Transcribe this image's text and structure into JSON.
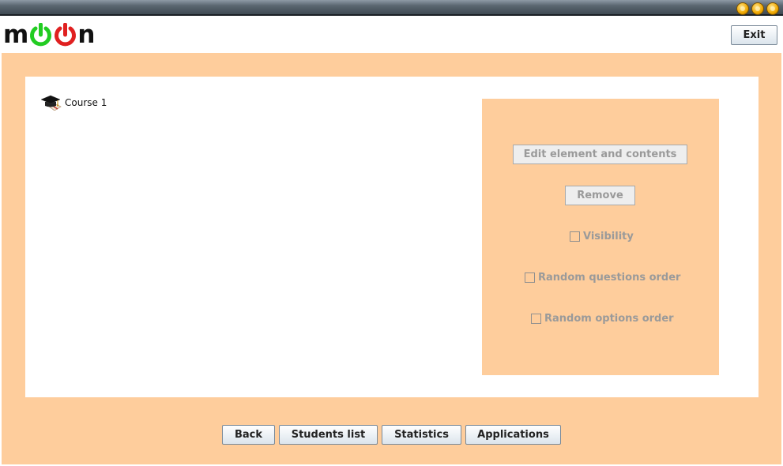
{
  "window": {
    "controls": [
      {
        "name": "minimize-icon"
      },
      {
        "name": "maximize-icon"
      },
      {
        "name": "close-icon"
      }
    ]
  },
  "header": {
    "logo": {
      "letters": [
        "m",
        "n"
      ],
      "power_colors": [
        "#22cc22",
        "#e02020"
      ]
    },
    "exit_label": "Exit"
  },
  "tree": {
    "items": [
      {
        "label": "Course 1",
        "icon": "graduation-cap-icon"
      }
    ]
  },
  "actions": {
    "edit_label": "Edit element and contents",
    "remove_label": "Remove",
    "visibility_label": "Visibility",
    "random_questions_label": "Random questions order",
    "random_options_label": "Random options order",
    "visibility_checked": false,
    "random_questions_checked": false,
    "random_options_checked": false
  },
  "footer": {
    "back_label": "Back",
    "students_label": "Students list",
    "statistics_label": "Statistics",
    "applications_label": "Applications"
  },
  "colors": {
    "background": "#fecd9c",
    "panel": "#ffffff",
    "disabled_text": "#9a9a9a"
  }
}
